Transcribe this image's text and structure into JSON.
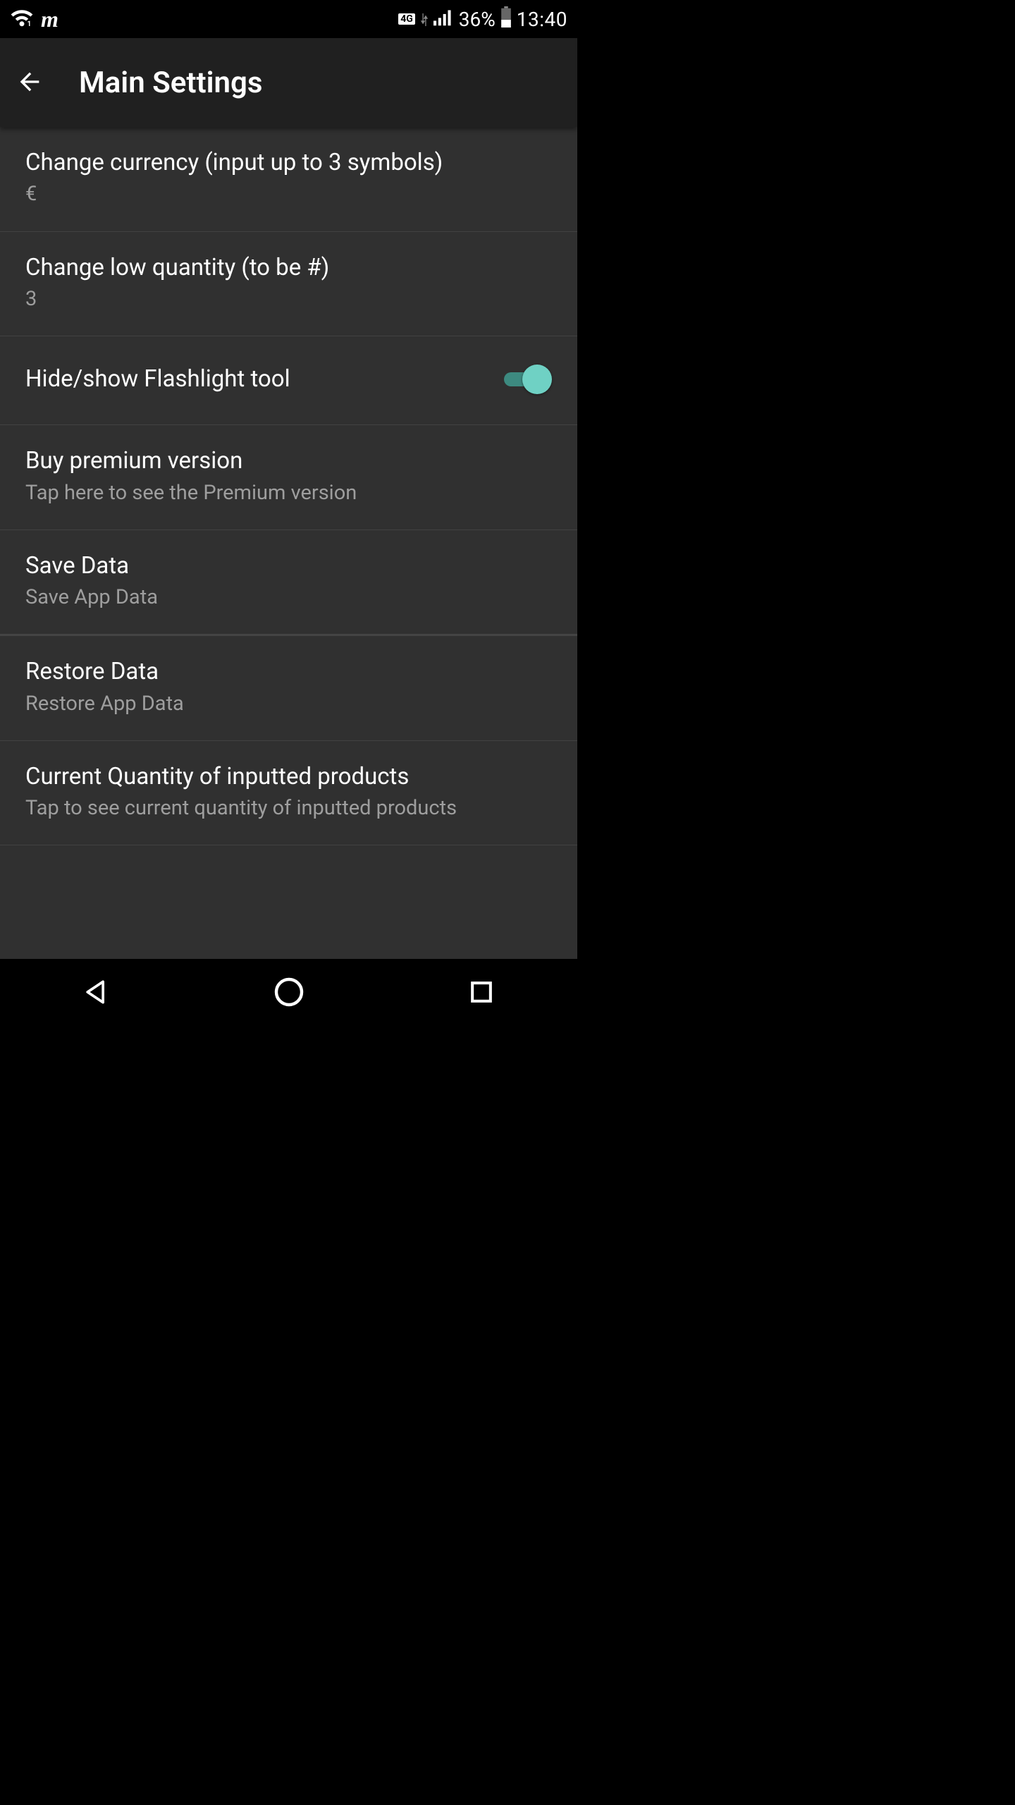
{
  "status": {
    "network_type": "4G",
    "battery_pct": "36%",
    "time": "13:40"
  },
  "header": {
    "title": "Main Settings"
  },
  "settings": {
    "currency": {
      "title": "Change currency (input up to 3 symbols)",
      "value": "€"
    },
    "low_qty": {
      "title": "Change low quantity (to be #)",
      "value": "3"
    },
    "flashlight": {
      "title": "Hide/show Flashlight tool",
      "enabled": true
    },
    "premium": {
      "title": "Buy premium version",
      "sub": "Tap here to see the Premium version"
    },
    "save": {
      "title": "Save Data",
      "sub": "Save App Data"
    },
    "restore": {
      "title": "Restore Data",
      "sub": "Restore App Data"
    },
    "current_qty": {
      "title": "Current Quantity of inputted products",
      "sub": "Tap to see current quantity of inputted products"
    }
  },
  "colors": {
    "accent": "#6fd1c4",
    "bg": "#303030",
    "appbar": "#202020",
    "divider": "#424242",
    "subtext": "#9e9e9e"
  }
}
